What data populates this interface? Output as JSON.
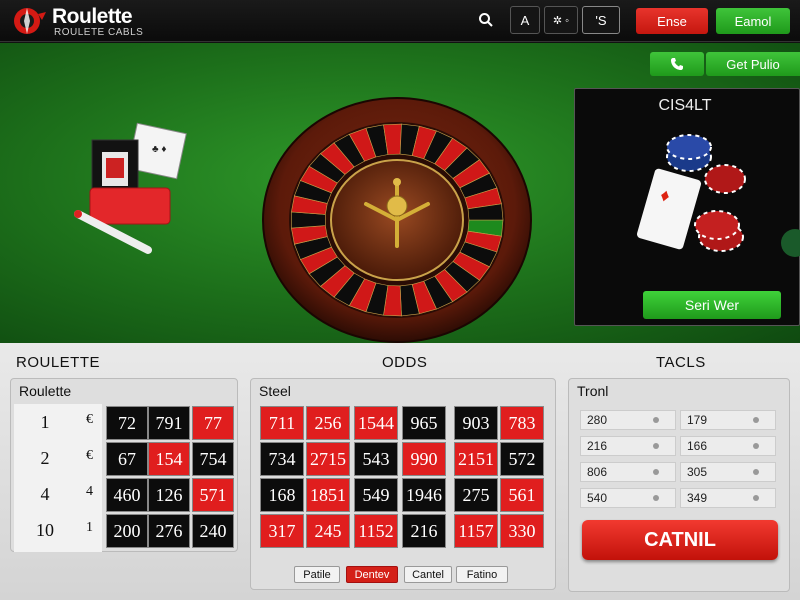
{
  "header": {
    "title": "Roulette",
    "subtitle": "ROULETE CABLS",
    "search_icon": "search-icon",
    "font_btn": "A",
    "settings_btn": "✲ ◦",
    "lang_btn": "'S",
    "red_btn": "Ense",
    "green_btn": "Eamol"
  },
  "felt": {
    "phone_icon": "phone-icon",
    "get_pro_label": "Get Pulio"
  },
  "side_panel": {
    "title": "CIS4LT",
    "start_label": "Seri Wer"
  },
  "sections": {
    "left_head": "ROULETTE",
    "middle_head": "ODDS",
    "right_head": "TACLS"
  },
  "left_panel": {
    "title": "Roulette",
    "rows": [
      {
        "label": "1",
        "mark": "€",
        "cells": [
          {
            "v": "72",
            "c": "black"
          },
          {
            "v": "791",
            "c": "black"
          },
          {
            "v": "77",
            "c": "red"
          }
        ]
      },
      {
        "label": "2",
        "mark": "€",
        "cells": [
          {
            "v": "67",
            "c": "black"
          },
          {
            "v": "154",
            "c": "red"
          },
          {
            "v": "754",
            "c": "black"
          }
        ]
      },
      {
        "label": "4",
        "mark": "4",
        "cells": [
          {
            "v": "460",
            "c": "black"
          },
          {
            "v": "126",
            "c": "black"
          },
          {
            "v": "571",
            "c": "red"
          }
        ]
      },
      {
        "label": "10",
        "mark": "1",
        "cells": [
          {
            "v": "200",
            "c": "black"
          },
          {
            "v": "276",
            "c": "black"
          },
          {
            "v": "240",
            "c": "black"
          }
        ]
      }
    ]
  },
  "middle_panel": {
    "title": "Steel",
    "rows": [
      [
        {
          "v": "711",
          "c": "red"
        },
        {
          "v": "256",
          "c": "red"
        },
        {
          "v": "1544",
          "c": "red"
        },
        {
          "v": "965",
          "c": "black"
        },
        {
          "v": "903",
          "c": "black"
        },
        {
          "v": "783",
          "c": "red"
        }
      ],
      [
        {
          "v": "734",
          "c": "black"
        },
        {
          "v": "2715",
          "c": "red"
        },
        {
          "v": "543",
          "c": "black"
        },
        {
          "v": "990",
          "c": "red"
        },
        {
          "v": "2151",
          "c": "red"
        },
        {
          "v": "572",
          "c": "black"
        }
      ],
      [
        {
          "v": "168",
          "c": "black"
        },
        {
          "v": "1851",
          "c": "red"
        },
        {
          "v": "549",
          "c": "black"
        },
        {
          "v": "1946",
          "c": "black"
        },
        {
          "v": "275",
          "c": "black"
        },
        {
          "v": "561",
          "c": "red"
        }
      ],
      [
        {
          "v": "317",
          "c": "red"
        },
        {
          "v": "245",
          "c": "red"
        },
        {
          "v": "1152",
          "c": "red"
        },
        {
          "v": "216",
          "c": "black"
        },
        {
          "v": "1157",
          "c": "red"
        },
        {
          "v": "330",
          "c": "red"
        }
      ]
    ],
    "buttons": [
      "Patile",
      "Dentev",
      "Cantel",
      "Fatino"
    ]
  },
  "right_panel": {
    "title": "Tronl",
    "rows": [
      [
        "280",
        "179"
      ],
      [
        "216",
        "166"
      ],
      [
        "806",
        "305"
      ],
      [
        "540",
        "349"
      ]
    ],
    "cancel_label": "CATNIL"
  },
  "colors": {
    "red": "#e01e1e",
    "black": "#0c0c0c",
    "green": "#2f9a2a"
  }
}
